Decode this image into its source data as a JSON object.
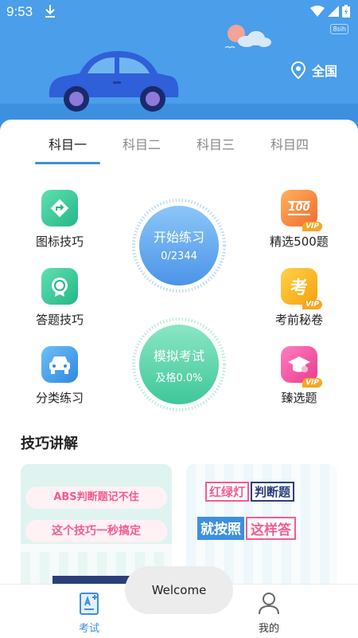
{
  "status_bar": {
    "time": "9:53",
    "speed": "8sih"
  },
  "header": {
    "location_label": "全国"
  },
  "subject_tabs": [
    {
      "label": "科目一",
      "active": true
    },
    {
      "label": "科目二",
      "active": false
    },
    {
      "label": "科目三",
      "active": false
    },
    {
      "label": "科目四",
      "active": false
    }
  ],
  "features": {
    "sign_tips": "图标技巧",
    "answer_tips": "答题技巧",
    "category_practice": "分类练习",
    "selected_500": "精选500题",
    "pre_exam_secret": "考前秘卷",
    "premium_questions": "臻选题",
    "vip_badge": "VIP",
    "selected_500_icon_text": "100",
    "pre_exam_icon_text": "考"
  },
  "practice": {
    "label": "开始练习",
    "progress": "0/2344"
  },
  "mock_exam": {
    "label": "模拟考试",
    "pass_rate": "及格0.0%"
  },
  "tips_section": {
    "title": "技巧讲解",
    "cards": [
      {
        "line1": "ABS判断题记不住",
        "line2": "这个技巧一秒搞定"
      },
      {
        "line1a": "红绿灯",
        "line1b": "判断题",
        "line2a": "就按照",
        "line2b": "这样答"
      }
    ]
  },
  "bottom_nav": [
    {
      "label": "考试",
      "active": true
    },
    {
      "label": "我的",
      "active": false
    }
  ],
  "toast": "Welcome",
  "colors": {
    "primary": "#3d8fe0",
    "header": "#4a9eea",
    "accent_pink": "#f25c8f"
  }
}
